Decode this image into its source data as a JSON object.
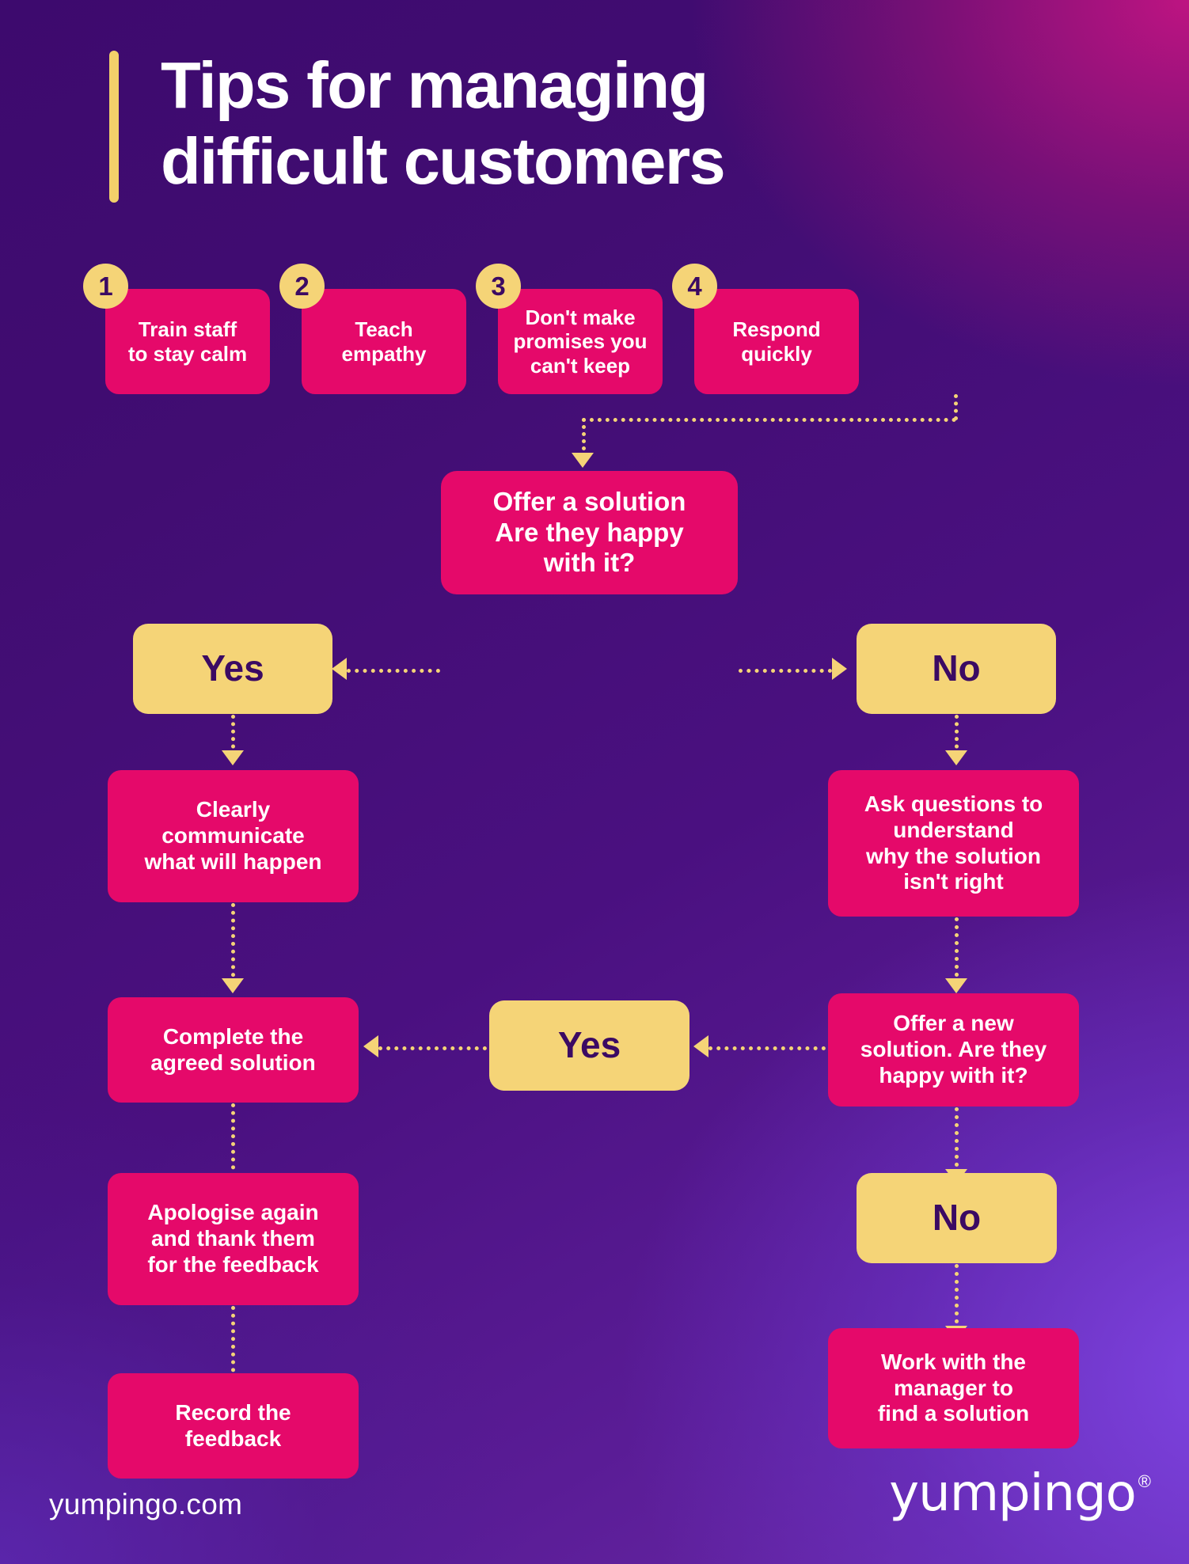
{
  "header": {
    "title": "Tips for managing\ndifficult customers",
    "accent_bar_color": "#f3d06a"
  },
  "colors": {
    "pink": "#e5096a",
    "yellow": "#f5d477",
    "deep_purple": "#3b0a63",
    "white": "#ffffff",
    "background_from": "#3d0a6e",
    "background_to": "#6a2aa8"
  },
  "tips": [
    {
      "number": "1",
      "label": "Train staff\nto stay calm"
    },
    {
      "number": "2",
      "label": "Teach\nempathy"
    },
    {
      "number": "3",
      "label": "Don't make\npromises you\ncan't keep"
    },
    {
      "number": "4",
      "label": "Respond\nquickly"
    }
  ],
  "flow": {
    "decision_1": "Offer a solution\nAre they happy\nwith it?",
    "yes_1": "Yes",
    "no_1": "No",
    "left_step_1": "Clearly\ncommunicate\nwhat will happen",
    "left_step_2": "Complete the\nagreed solution",
    "left_step_3": "Apologise again\nand thank them\nfor the feedback",
    "left_step_4": "Record the\nfeedback",
    "right_step_1": "Ask questions to\nunderstand\nwhy the solution\nisn't right",
    "decision_2": "Offer a new\nsolution. Are they\nhappy with it?",
    "yes_2": "Yes",
    "no_2": "No",
    "right_step_2": "Work with the\nmanager to\nfind a solution"
  },
  "footer": {
    "url": "yumpingo.com",
    "logo": "yumpingo",
    "registered_mark": "®"
  }
}
